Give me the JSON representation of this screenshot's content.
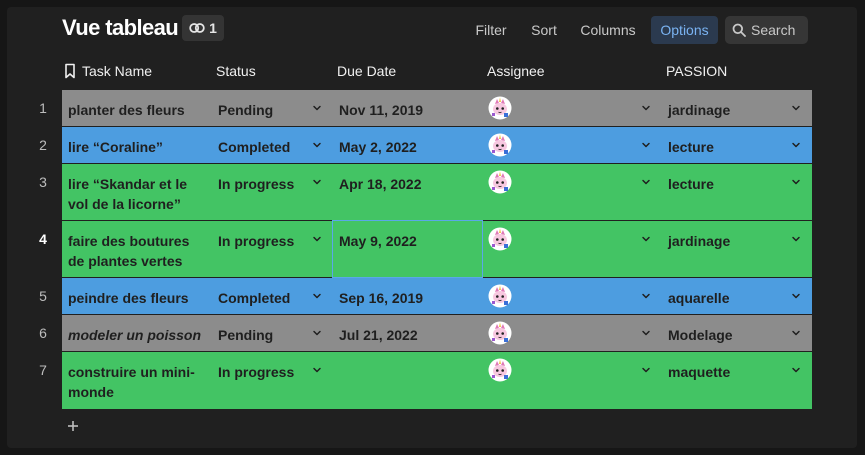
{
  "header": {
    "title": "Vue tableau",
    "link_count": "1"
  },
  "toolbar": {
    "filter": "Filter",
    "sort": "Sort",
    "columns": "Columns",
    "options": "Options",
    "search": "Search"
  },
  "columns": [
    "Task Name",
    "Status",
    "Due Date",
    "Assignee",
    "PASSION"
  ],
  "colors": {
    "pending": "#8c8c8c",
    "completed": "#4d9de0",
    "in_progress": "#43c464",
    "accent": "#7ab3f2"
  },
  "rows": [
    {
      "num": "1",
      "task": "planter des fleurs",
      "status": "Pending",
      "due": "Nov 11, 2019",
      "passion": "jardinage",
      "italic": false
    },
    {
      "num": "2",
      "task": "lire “Coraline”",
      "status": "Completed",
      "due": "May 2, 2022",
      "passion": "lecture",
      "italic": false
    },
    {
      "num": "3",
      "task": "lire “Skandar et le vol de la licorne”",
      "status": "In progress",
      "due": "Apr 18, 2022",
      "passion": "lecture",
      "italic": false
    },
    {
      "num": "4",
      "task": "faire des boutures de plantes vertes",
      "status": "In progress",
      "due": "May 9, 2022",
      "passion": "jardinage",
      "italic": false
    },
    {
      "num": "5",
      "task": "peindre des fleurs",
      "status": "Completed",
      "due": "Sep 16, 2019",
      "passion": "aquarelle",
      "italic": false
    },
    {
      "num": "6",
      "task": "modeler un poisson",
      "status": "Pending",
      "due": "Jul 21, 2022",
      "passion": "Modelage",
      "italic": true
    },
    {
      "num": "7",
      "task": "construire un mini-monde",
      "status": "In progress",
      "due": "",
      "passion": "maquette",
      "italic": false
    }
  ],
  "add_row_icon": "plus-icon",
  "assignee_icon": "unicorn-avatar-icon"
}
